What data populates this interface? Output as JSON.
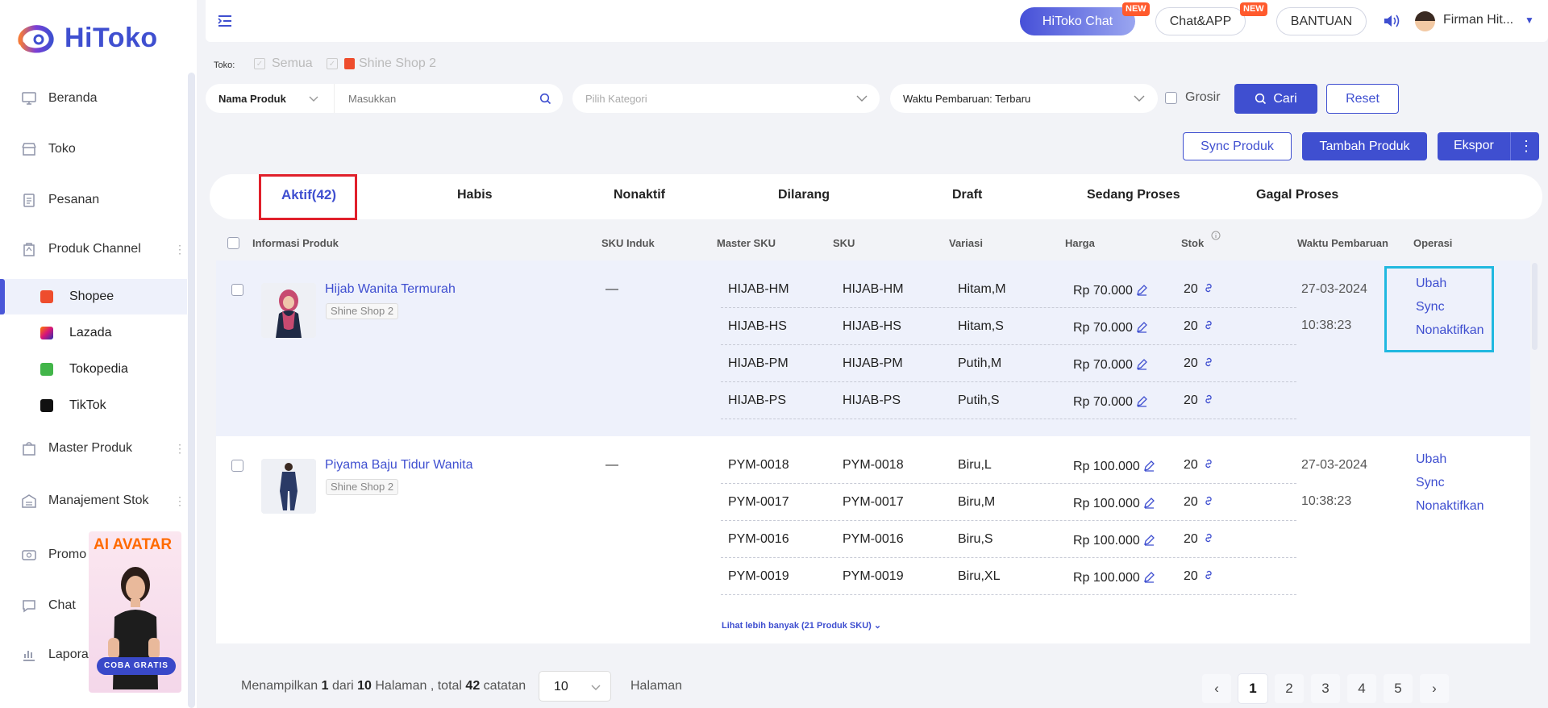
{
  "brand": {
    "name": "HiToko"
  },
  "sidebar": {
    "items": [
      {
        "label": "Beranda",
        "icon": "monitor-icon"
      },
      {
        "label": "Toko",
        "icon": "store-icon"
      },
      {
        "label": "Pesanan",
        "icon": "clipboard-icon"
      },
      {
        "label": "Produk Channel",
        "icon": "product-icon"
      },
      {
        "label": "Master Produk",
        "icon": "bag-icon"
      },
      {
        "label": "Manajement Stok",
        "icon": "warehouse-icon"
      },
      {
        "label": "Promo",
        "icon": "promo-icon"
      },
      {
        "label": "Chat",
        "icon": "chat-icon"
      },
      {
        "label": "Lapora",
        "icon": "report-icon"
      }
    ],
    "channels": [
      {
        "label": "Shopee",
        "color": "#ee4d2d"
      },
      {
        "label": "Lazada",
        "color": "#2a2fb0"
      },
      {
        "label": "Tokopedia",
        "color": "#42b549"
      },
      {
        "label": "TikTok",
        "color": "#111111"
      }
    ],
    "banner": {
      "title": "AI",
      "title2": "AVATAR",
      "cta": "COBA GRATIS"
    }
  },
  "topbar": {
    "hitoko_chat": "HiToko Chat",
    "chat_app": "Chat&APP",
    "new_badge": "NEW",
    "bantuan": "BANTUAN",
    "user": "Firman Hit..."
  },
  "filter": {
    "toko_label": "Toko:",
    "semua": "Semua",
    "shop": "Shine Shop 2",
    "field_select": "Nama Produk",
    "search_placeholder": "Masukkan",
    "category_placeholder": "Pilih Kategori",
    "sort": "Waktu Pembaruan: Terbaru",
    "grosir": "Grosir",
    "cari": "Cari",
    "reset": "Reset"
  },
  "actions": {
    "sync": "Sync Produk",
    "tambah": "Tambah Produk",
    "ekspor": "Ekspor"
  },
  "tabs": [
    "Aktif(42)",
    "Habis",
    "Nonaktif",
    "Dilarang",
    "Draft",
    "Sedang Proses",
    "Gagal Proses"
  ],
  "columns": [
    "Informasi Produk",
    "SKU Induk",
    "Master SKU",
    "SKU",
    "Variasi",
    "Harga",
    "Stok",
    "Waktu Pembaruan",
    "Operasi"
  ],
  "products": [
    {
      "name": "Hijab Wanita Termurah",
      "shop": "Shine Shop 2",
      "sku_induk": "—",
      "date": "27-03-2024",
      "time": "10:38:23",
      "variants": [
        {
          "master": "HIJAB-HM",
          "sku": "HIJAB-HM",
          "var": "Hitam,M",
          "price": "Rp 70.000",
          "stock": "20"
        },
        {
          "master": "HIJAB-HS",
          "sku": "HIJAB-HS",
          "var": "Hitam,S",
          "price": "Rp 70.000",
          "stock": "20"
        },
        {
          "master": "HIJAB-PM",
          "sku": "HIJAB-PM",
          "var": "Putih,M",
          "price": "Rp 70.000",
          "stock": "20"
        },
        {
          "master": "HIJAB-PS",
          "sku": "HIJAB-PS",
          "var": "Putih,S",
          "price": "Rp 70.000",
          "stock": "20"
        }
      ]
    },
    {
      "name": "Piyama Baju Tidur Wanita",
      "shop": "Shine Shop 2",
      "sku_induk": "—",
      "date": "27-03-2024",
      "time": "10:38:23",
      "more": "Lihat lebih banyak (21 Produk SKU)",
      "variants": [
        {
          "master": "PYM-0018",
          "sku": "PYM-0018",
          "var": "Biru,L",
          "price": "Rp 100.000",
          "stock": "20"
        },
        {
          "master": "PYM-0017",
          "sku": "PYM-0017",
          "var": "Biru,M",
          "price": "Rp 100.000",
          "stock": "20"
        },
        {
          "master": "PYM-0016",
          "sku": "PYM-0016",
          "var": "Biru,S",
          "price": "Rp 100.000",
          "stock": "20"
        },
        {
          "master": "PYM-0019",
          "sku": "PYM-0019",
          "var": "Biru,XL",
          "price": "Rp 100.000",
          "stock": "20"
        }
      ]
    }
  ],
  "operations": [
    "Ubah",
    "Sync",
    "Nonaktifkan"
  ],
  "footer": {
    "t1": "Menampilkan",
    "current": "1",
    "t2": "dari",
    "pages": "10",
    "t3": "Halaman , total",
    "total": "42",
    "t4": "catatan",
    "per_page": "10",
    "halaman": "Halaman",
    "page_numbers": [
      "1",
      "2",
      "3",
      "4",
      "5"
    ]
  },
  "colors": {
    "accent": "#3f4fd0",
    "highlight_tab": "#e0202b",
    "highlight_ops": "#20b8e0"
  }
}
